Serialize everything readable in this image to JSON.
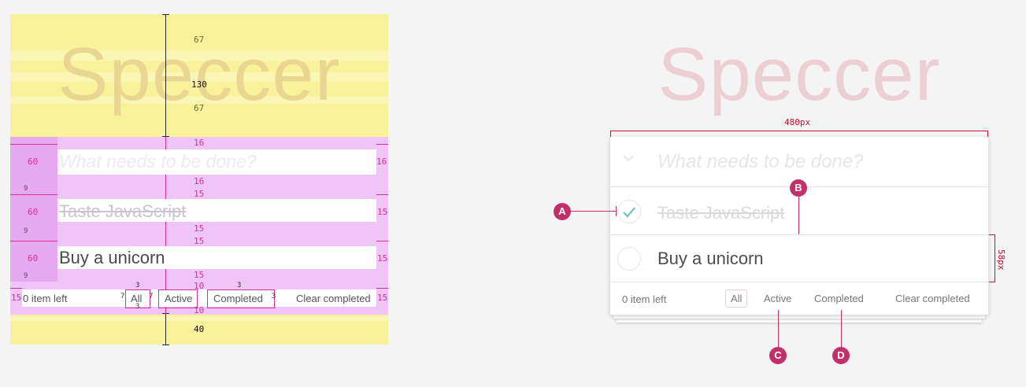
{
  "watermark": "Speccer",
  "todo": {
    "placeholder": "What needs to be done?",
    "items": [
      {
        "text": "Taste JavaScript",
        "completed": true
      },
      {
        "text": "Buy a unicorn",
        "completed": false
      }
    ],
    "footer": {
      "count": "0 item left",
      "filters": [
        "All",
        "Active",
        "Completed"
      ],
      "selected_filter": "All",
      "clear": "Clear completed"
    }
  },
  "spacing_spec": {
    "header_top": "67",
    "header_total": "130",
    "header_bottom": "67",
    "bottom_margin": "40",
    "padding_16": "16",
    "padding_15": "15",
    "padding_10": "10",
    "padding_9": "9",
    "padding_3": "3",
    "padding_7": "7",
    "row_60": "60"
  },
  "measure": {
    "width_label": "480px",
    "height_label": "58px"
  },
  "annotations": [
    "A",
    "B",
    "C",
    "D"
  ],
  "colors": {
    "accent": "#c2306c",
    "measure_red": "#c8102e",
    "spacing_pink": "#d6338f",
    "margin_yellow": "#f8f39a",
    "check_green": "#5dc2af"
  }
}
